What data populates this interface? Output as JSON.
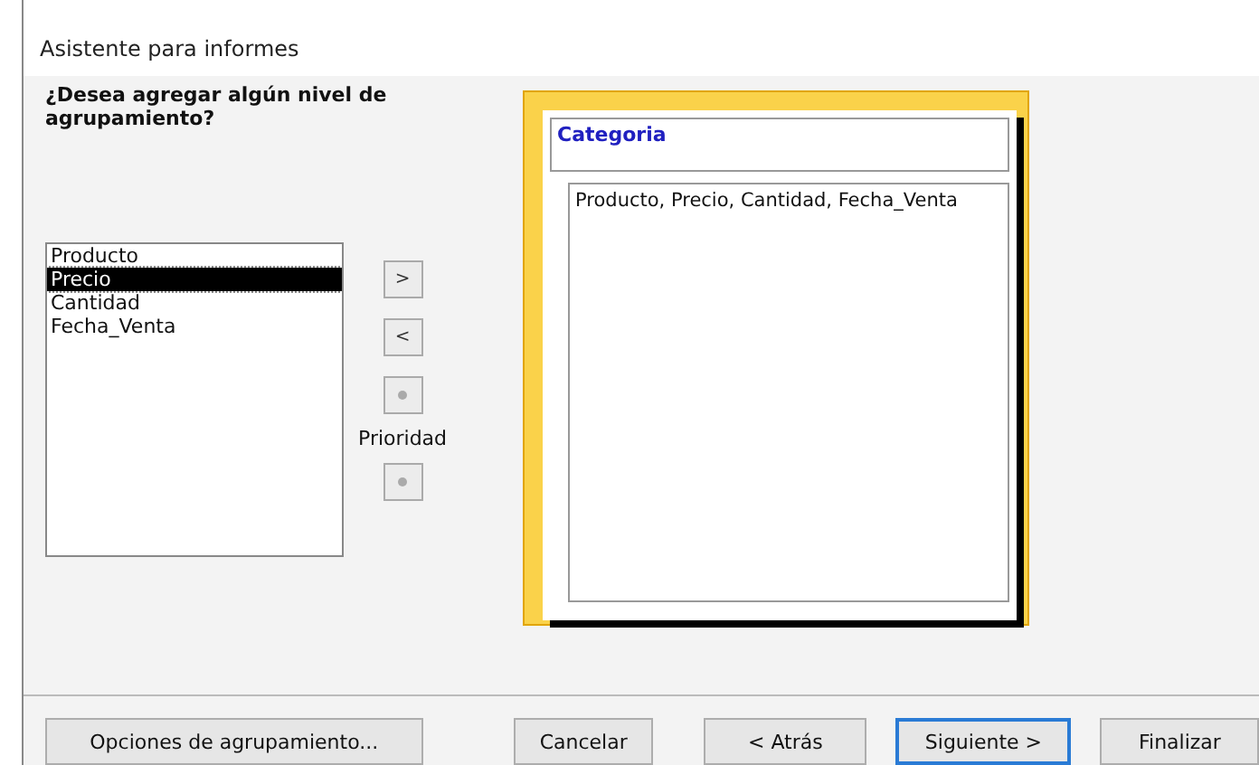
{
  "window": {
    "title": "Asistente para informes"
  },
  "question": "¿Desea agregar algún nivel de agrupamiento?",
  "fields": [
    {
      "label": "Producto",
      "selected": false
    },
    {
      "label": "Precio",
      "selected": true
    },
    {
      "label": "Cantidad",
      "selected": false
    },
    {
      "label": "Fecha_Venta",
      "selected": false
    }
  ],
  "move_buttons": [
    {
      "label": ">",
      "disabled": false
    },
    {
      "label": "<",
      "disabled": false
    }
  ],
  "priority": {
    "label": "Prioridad",
    "up_disabled": true,
    "down_disabled": true
  },
  "preview": {
    "group": "Categoria",
    "detail": "Producto, Precio, Cantidad, Fecha_Venta"
  },
  "buttons": [
    {
      "label": "Opciones de agrupamiento...",
      "focused": false
    },
    {
      "label": "Cancelar",
      "focused": false
    },
    {
      "label": "< Atrás",
      "focused": false
    },
    {
      "label": "Siguiente >",
      "focused": true
    },
    {
      "label": "Finalizar",
      "focused": false
    }
  ]
}
